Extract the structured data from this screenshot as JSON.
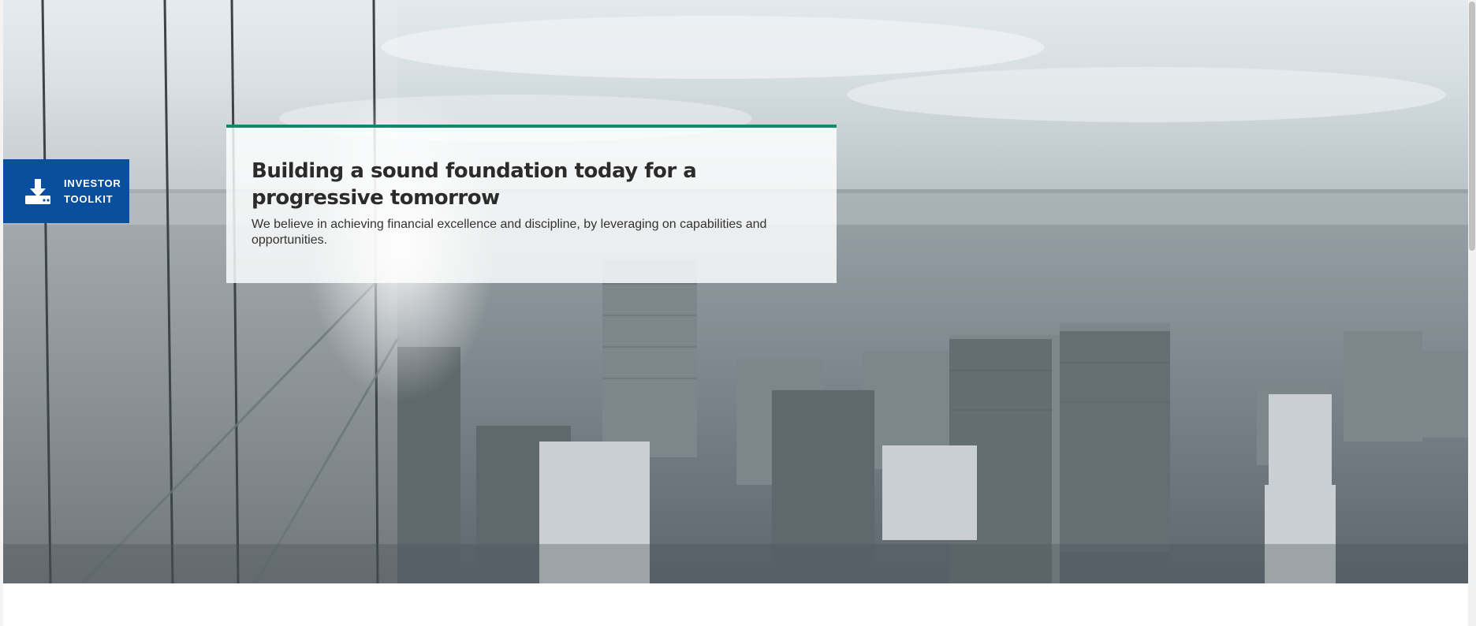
{
  "hero": {
    "headline": "Building a sound foundation today for a progressive tomorrow",
    "description": "We believe in achieving financial excellence and discipline, by leveraging on capabilities and opportunities.",
    "accent_color": "#0f8a6b"
  },
  "investor_toolkit": {
    "line1": "INVESTOR",
    "line2": "TOOLKIT",
    "icon": "download-icon",
    "bg_color": "#0a4f9e"
  }
}
